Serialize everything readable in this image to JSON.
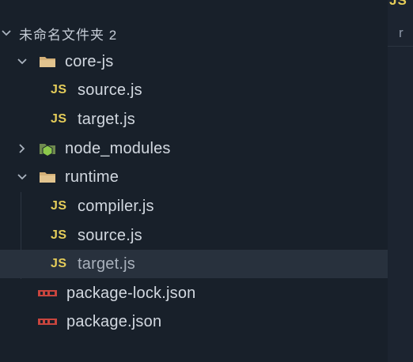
{
  "explorer": {
    "root": {
      "label": "未命名文件夹 2"
    },
    "items": [
      {
        "label": "core-js",
        "kind": "folder",
        "expanded": true
      },
      {
        "label": "source.js",
        "kind": "js",
        "icon": "JS"
      },
      {
        "label": "target.js",
        "kind": "js",
        "icon": "JS"
      },
      {
        "label": "node_modules",
        "kind": "folder-node",
        "expanded": false
      },
      {
        "label": "runtime",
        "kind": "folder",
        "expanded": true
      },
      {
        "label": "compiler.js",
        "kind": "js",
        "icon": "JS"
      },
      {
        "label": "source.js",
        "kind": "js",
        "icon": "JS"
      },
      {
        "label": "target.js",
        "kind": "js",
        "icon": "JS",
        "selected": true
      },
      {
        "label": "package-lock.json",
        "kind": "npm"
      },
      {
        "label": "package.json",
        "kind": "npm"
      }
    ]
  },
  "editor": {
    "tab_icon": "JS",
    "ghost_char": "r"
  },
  "colors": {
    "js_yellow": "#e5cd5a",
    "folder_tan": "#d4b078",
    "npm_red": "#c8453e",
    "node_green": "#8cc84b"
  }
}
